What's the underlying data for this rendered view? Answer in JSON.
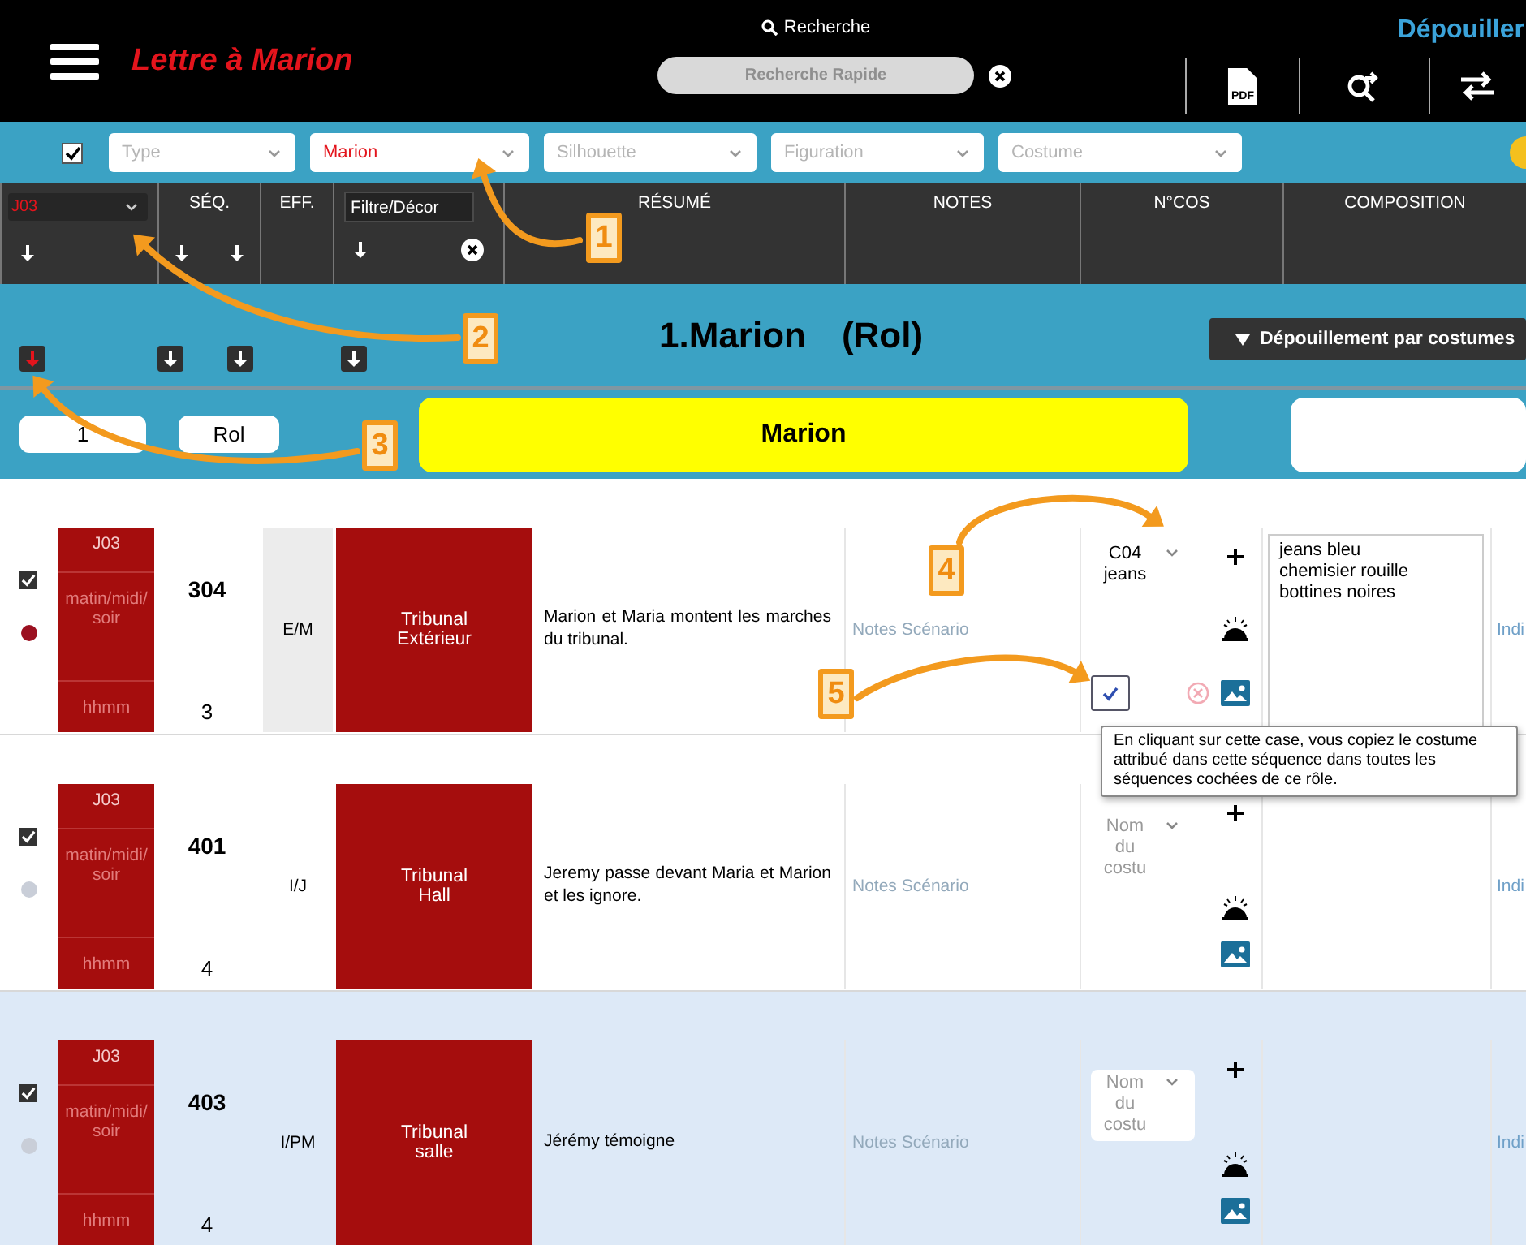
{
  "header": {
    "title": "Lettre à Marion",
    "search_label": "Recherche",
    "search_placeholder": "Recherche Rapide",
    "mode_title": "Dépouiller",
    "pdf_label": "PDF"
  },
  "filters": {
    "all_checked": true,
    "dropdowns": [
      {
        "placeholder": "Type"
      },
      {
        "value": "Marion"
      },
      {
        "placeholder": "Silhouette"
      },
      {
        "placeholder": "Figuration"
      },
      {
        "placeholder": "Costume"
      }
    ]
  },
  "columns": {
    "day_filter": "J03",
    "sequence": "SÉQ.",
    "effect": "EFF.",
    "decor_filter": "Filtre/Décor",
    "summary": "RÉSUMÉ",
    "notes": "NOTES",
    "costume_number": "N°COS",
    "composition": "COMPOSITION"
  },
  "role": {
    "title": "1.Marion",
    "type": "(Rol)",
    "menu_button": "Dépouillement par costumes",
    "number": "1",
    "role_type": "Rol",
    "name": "Marion",
    "sort_buttons": [
      {
        "active": true
      },
      {
        "active": false
      },
      {
        "active": false
      },
      {
        "active": false
      }
    ]
  },
  "rows": [
    {
      "checked": true,
      "color": "#9b1020",
      "selected": false,
      "day": "J03",
      "time_of_day": "matin/midi/soir",
      "time": "hhmm",
      "sequence": "304",
      "count": "3",
      "effect": "E/M",
      "effect_shaded": true,
      "decor": "Tribunal Extérieur",
      "summary": "Marion et Maria montent les marches du tribunal.",
      "notes": "Notes Scénario",
      "costume": {
        "value": "C04 jeans"
      },
      "copy_checked": true,
      "composition": "jeans bleu\nchemisier rouille\nbottines noires",
      "last_column": "Indi"
    },
    {
      "checked": true,
      "color": "#c9ced8",
      "selected": false,
      "day": "J03",
      "time_of_day": "matin/midi/soir",
      "time": "hhmm",
      "sequence": "401",
      "count": "4",
      "effect": "I/J",
      "effect_shaded": false,
      "decor": "Tribunal Hall",
      "summary": "Jeremy passe devant Maria et Marion et les ignore.",
      "notes": "Notes Scénario",
      "costume": {
        "placeholder": "Nom du costu"
      },
      "last_column": "Indi"
    },
    {
      "checked": true,
      "color": "#c9ced8",
      "selected": true,
      "day": "J03",
      "time_of_day": "matin/midi/soir",
      "time": "hhmm",
      "sequence": "403",
      "count": "4",
      "effect": "I/PM",
      "effect_shaded": false,
      "decor": "Tribunal salle",
      "summary": "Jérémy témoigne",
      "notes": "Notes Scénario",
      "costume": {
        "placeholder": "Nom du costu"
      },
      "last_column": "Indi"
    }
  ],
  "tooltip": "En cliquant sur cette case, vous copiez le costume attribué dans cette séquence dans toutes les séquences cochées de ce rôle.",
  "annotations": [
    {
      "label": "1"
    },
    {
      "label": "2"
    },
    {
      "label": "3"
    },
    {
      "label": "4"
    },
    {
      "label": "5"
    }
  ]
}
